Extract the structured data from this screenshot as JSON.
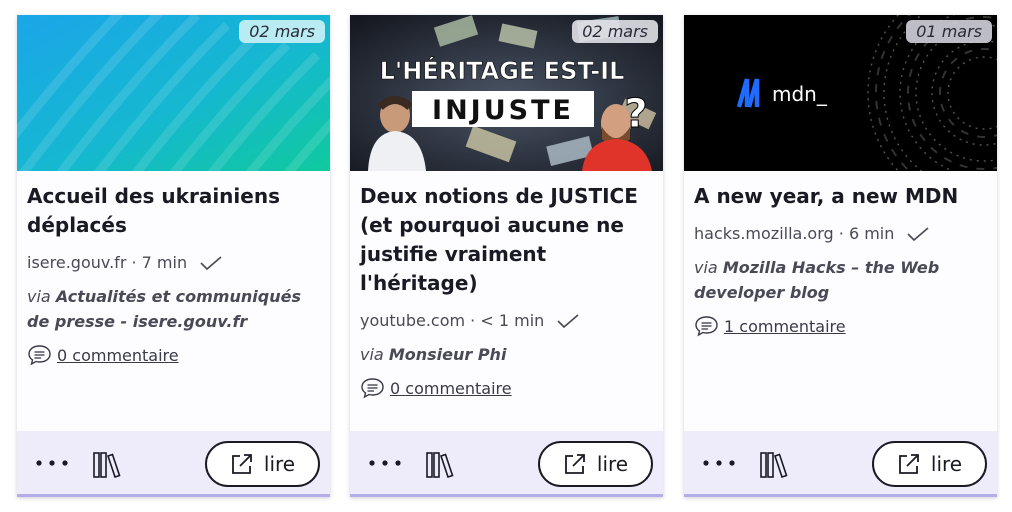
{
  "cards": [
    {
      "date": "02 mars",
      "title": "Accueil des ukrainiens déplacés",
      "domain": "isere.gouv.fr",
      "reading_time": "7 min",
      "via_prefix": "via",
      "source": "Actualités et communiqués de presse - isere.gouv.fr",
      "comments": "0 commentaire",
      "read_label": "lire"
    },
    {
      "date": "02 mars",
      "title": "Deux notions de JUSTICE (et pourquoi aucune ne justifie vraiment l'héritage)",
      "thumb_line1": "L'HÉRITAGE EST-IL",
      "thumb_line2": "INJUSTE",
      "thumb_q": "?",
      "domain": "youtube.com",
      "reading_time": "< 1 min",
      "via_prefix": "via",
      "source": "Monsieur Phi",
      "comments": "0 commentaire",
      "read_label": "lire"
    },
    {
      "date": "01 mars",
      "title": "A new year, a new MDN",
      "thumb_logo": "mdn_",
      "domain": "hacks.mozilla.org",
      "reading_time": "6 min",
      "via_prefix": "via",
      "source": "Mozilla Hacks – the Web developer blog",
      "comments": "1 commentaire",
      "read_label": "lire"
    }
  ],
  "icons": {
    "check": "check-icon",
    "comment": "comment-icon",
    "more": "more-dots-icon",
    "library": "library-books-icon",
    "external": "external-link-icon"
  },
  "colors": {
    "card_bg": "#fdfcff",
    "footer_bg": "#eeecfb",
    "accent_border": "#b4aee8",
    "mdn_blue": "#1e6bff"
  }
}
